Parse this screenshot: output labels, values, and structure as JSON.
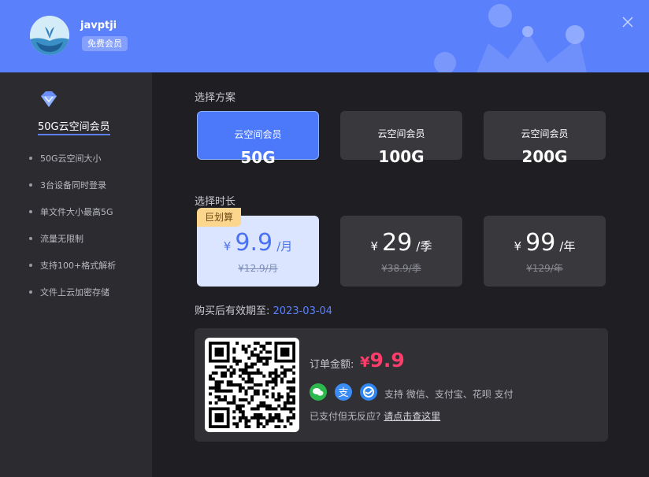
{
  "header": {
    "username": "javptji",
    "member_badge": "免费会员",
    "bg_color": "#5b80fb"
  },
  "sidebar": {
    "title": "50G云空间会员",
    "icon": "diamond-icon",
    "features": [
      "50G云空间大小",
      "3台设备同时登录",
      "单文件大小最高5G",
      "流量无限制",
      "支持100+格式解析",
      "文件上云加密存储"
    ]
  },
  "plans": {
    "label": "选择方案",
    "items": [
      {
        "title": "云空间会员",
        "size": "50G",
        "selected": true
      },
      {
        "title": "云空间会员",
        "size": "100G",
        "selected": false
      },
      {
        "title": "云空间会员",
        "size": "200G",
        "selected": false
      }
    ]
  },
  "durations": {
    "label": "选择时长",
    "deal_badge": "巨划算",
    "items": [
      {
        "currency": "¥",
        "amount": "9.9",
        "unit": "/月",
        "original": "¥12.9/月",
        "selected": true
      },
      {
        "currency": "¥",
        "amount": "29",
        "unit": "/季",
        "original": "¥38.9/季",
        "selected": false
      },
      {
        "currency": "¥",
        "amount": "99",
        "unit": "/年",
        "original": "¥129/年",
        "selected": false
      }
    ]
  },
  "expiry": {
    "label": "购买后有效期至:",
    "date": "2023-03-04"
  },
  "payment": {
    "order_label": "订单金额:",
    "currency": "¥",
    "amount": "9.9",
    "methods_text": "支持  微信、支付宝、花呗  支付",
    "help_text": "已支付但无反应?",
    "help_link": "请点击查这里",
    "icons": [
      "wechat-pay-icon",
      "alipay-icon",
      "huabei-icon"
    ]
  },
  "colors": {
    "accent": "#5b80fb",
    "price_red": "#ff3d6b",
    "deal_gold": "#fdd68d"
  }
}
